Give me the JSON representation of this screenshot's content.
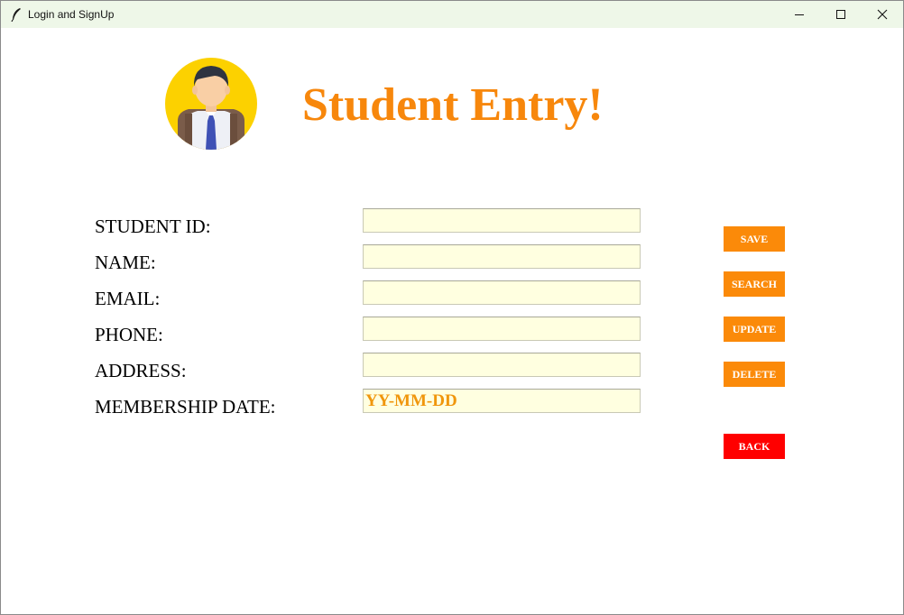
{
  "window": {
    "title": "Login and SignUp",
    "icon": "feather-icon",
    "controls": {
      "minimize": "minimize-icon",
      "maximize": "maximize-icon",
      "close": "close-icon"
    }
  },
  "header": {
    "title": "Student Entry!",
    "avatar": "student-avatar-icon"
  },
  "form": {
    "student_id_label": "STUDENT ID:",
    "student_id_value": "",
    "name_label": "NAME:",
    "name_value": "",
    "email_label": "EMAIL:",
    "email_value": "",
    "phone_label": "PHONE:",
    "phone_value": "",
    "address_label": "ADDRESS:",
    "address_value": "",
    "membership_date_label": "MEMBERSHIP DATE:",
    "membership_date_value": "YY-MM-DD"
  },
  "actions": {
    "save": "SAVE",
    "search": "SEARCH",
    "update": "UPDATE",
    "delete": "DELETE",
    "back": "BACK"
  },
  "colors": {
    "accent": "#f7870c",
    "button": "#fb8a09",
    "back_button": "#ff0000",
    "field_bg": "#ffffe0",
    "titlebar_bg": "#eef7e8"
  }
}
